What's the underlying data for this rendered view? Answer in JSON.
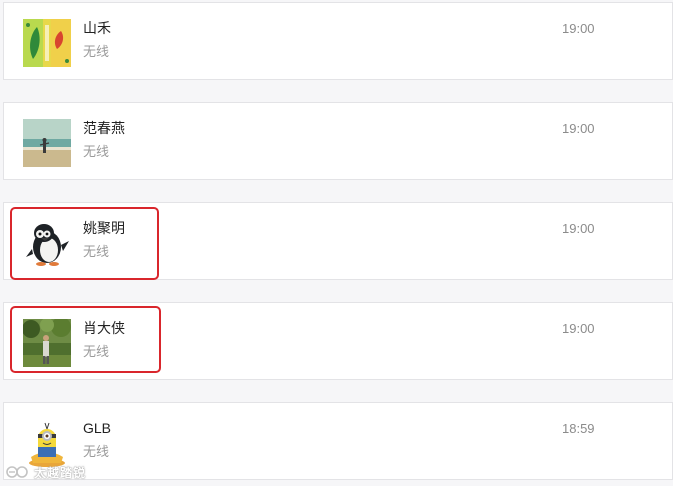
{
  "contacts": [
    {
      "name": "山禾",
      "status": "无线",
      "time": "19:00",
      "avatar_icon": "leaf-poster-avatar-icon"
    },
    {
      "name": "范春燕",
      "status": "无线",
      "time": "19:00",
      "avatar_icon": "beach-photo-avatar-icon"
    },
    {
      "name": "姚聚明",
      "status": "无线",
      "time": "19:00",
      "avatar_icon": "penguin-avatar-icon"
    },
    {
      "name": "肖大侠",
      "status": "无线",
      "time": "19:00",
      "avatar_icon": "forest-photo-avatar-icon"
    },
    {
      "name": "GLB",
      "status": "无线",
      "time": "18:59",
      "avatar_icon": "minion-avatar-icon"
    }
  ],
  "highlighted_contacts": [
    "姚聚明",
    "肖大侠"
  ],
  "watermark": {
    "text": "太越踏锐"
  },
  "colors": {
    "highlight": "#d9262c",
    "name_text": "#222222",
    "status_text": "#9a9a9a",
    "time_text": "#8b8b8b",
    "background": "#f6f6f8"
  }
}
